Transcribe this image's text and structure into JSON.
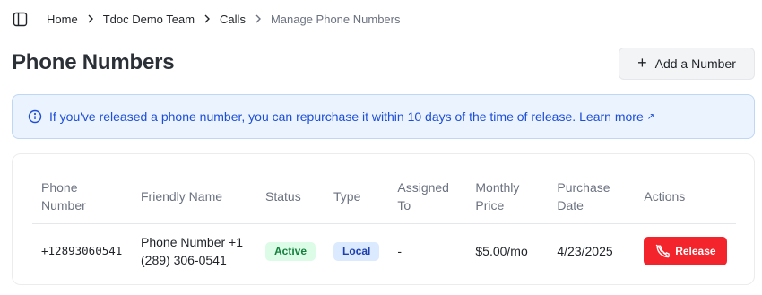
{
  "breadcrumb": {
    "items": [
      "Home",
      "Tdoc Demo Team",
      "Calls"
    ],
    "current": "Manage Phone Numbers"
  },
  "icons": {
    "sidebar_toggle": "sidebar-toggle-icon",
    "separator": "chevron-right-icon",
    "add": "plus-icon",
    "info": "info-circle-icon",
    "external": "arrow-up-right-icon",
    "release": "phone-off-icon"
  },
  "page": {
    "title": "Phone Numbers",
    "add_button_label": "Add a Number"
  },
  "alert": {
    "text": "If you've released a phone number, you can repurchase it within 10 days of the time of release.",
    "link_label": "Learn more",
    "link_suffix": "↗"
  },
  "table": {
    "headers": {
      "phone_1": "Phone",
      "phone_2": "Number",
      "friendly": "Friendly Name",
      "status": "Status",
      "type": "Type",
      "assigned_1": "Assigned",
      "assigned_2": "To",
      "price_1": "Monthly",
      "price_2": "Price",
      "date_1": "Purchase",
      "date_2": "Date",
      "actions": "Actions"
    },
    "rows": [
      {
        "phone": "+12893060541",
        "friendly_1": "Phone Number +1",
        "friendly_2": "(289) 306-0541",
        "status": "Active",
        "type": "Local",
        "assigned": "-",
        "price": "$5.00/mo",
        "date": "4/23/2025",
        "action_label": "Release"
      }
    ]
  },
  "colors": {
    "alert_bg": "#eaf3fe",
    "alert_text": "#1d4ed8",
    "release": "#f4242c",
    "badge_active_bg": "#dcfce7",
    "badge_active_text": "#15803d",
    "badge_local_bg": "#dbeafe",
    "badge_local_text": "#1e40af"
  }
}
